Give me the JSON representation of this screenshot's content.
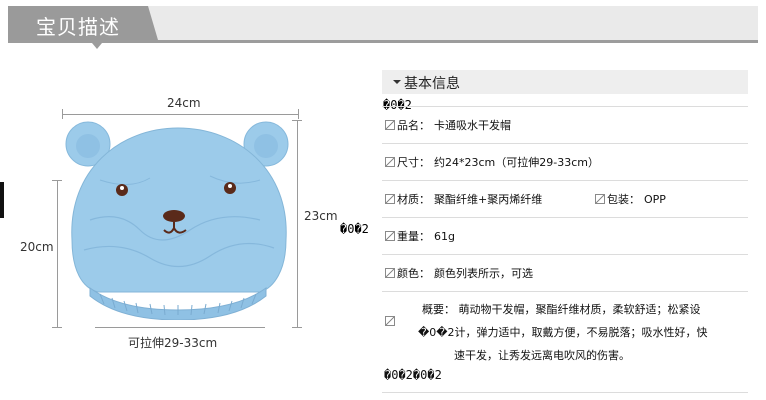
{
  "header": {
    "title": "宝贝描述"
  },
  "product_image": {
    "width_label": "24cm",
    "height_label_left": "20cm",
    "height_label_right": "23cm",
    "stretch_label": "可拉伸29-33cm",
    "cap_color": "#9ccbea"
  },
  "info": {
    "section_title": "基本信息",
    "garbled_top": "�0�2",
    "garbled_mid": "�0�2",
    "rows": [
      {
        "label": "品名：",
        "value": "卡通吸水干发帽"
      },
      {
        "label": "尺寸：",
        "value": "约24*23cm（可拉伸29-33cm）"
      },
      {
        "label": "材质：",
        "value": "聚酯纤维+聚丙烯纤维",
        "label2": "包装：",
        "value2": "OPP"
      },
      {
        "label": "重量：",
        "value": "61g"
      },
      {
        "label": "颜色：",
        "value": "颜色列表所示，可选"
      }
    ],
    "summary": {
      "line1": "概要： 萌动物干发帽，聚酯纤维材质，柔软舒适；松紧设",
      "line2": "�0�2计，弹力适中，取戴方便，不易脱落；吸水性好，快",
      "line3": "速干发，让秀发远离电吹风的伤害。",
      "tail": "�0�2�0�2"
    }
  }
}
